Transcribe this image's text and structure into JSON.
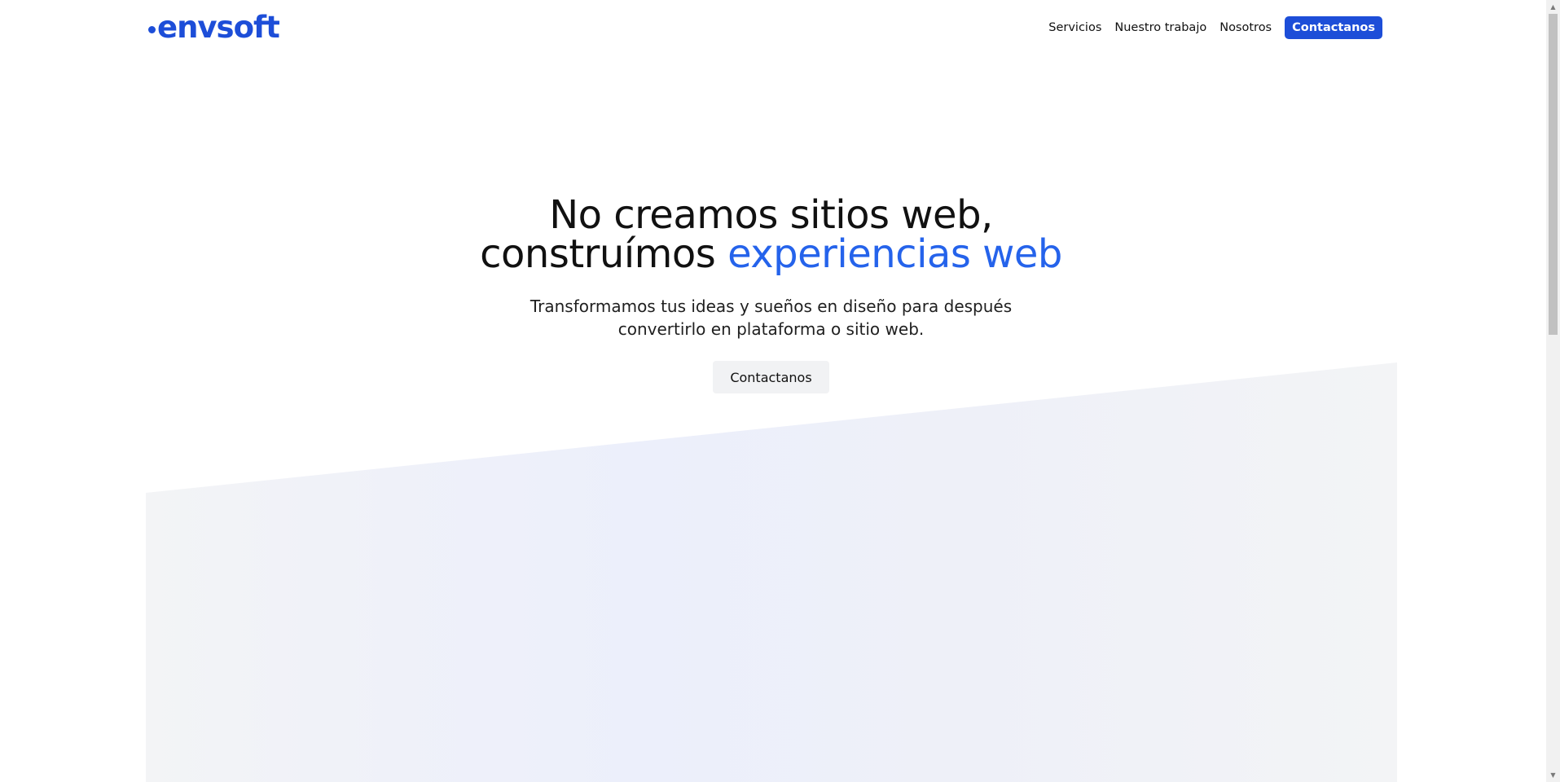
{
  "brand": {
    "logo_text": "envsoft",
    "color": "#1d4ed8"
  },
  "nav": {
    "links": [
      {
        "label": "Servicios"
      },
      {
        "label": "Nuestro trabajo"
      },
      {
        "label": "Nosotros"
      }
    ],
    "cta_label": "Contactanos"
  },
  "hero": {
    "title_line1": "No creamos sitios web,",
    "title_line2_prefix": "construímos",
    "title_line2_accent": "experiencias web",
    "accent_color": "#2563eb",
    "subtitle": "Transformamos tus ideas y sueños en diseño para después convertirlo en plataforma o sitio web.",
    "cta_label": "Contactanos"
  },
  "scrollbar": {
    "up_icon": "▲",
    "down_icon": "▼"
  }
}
